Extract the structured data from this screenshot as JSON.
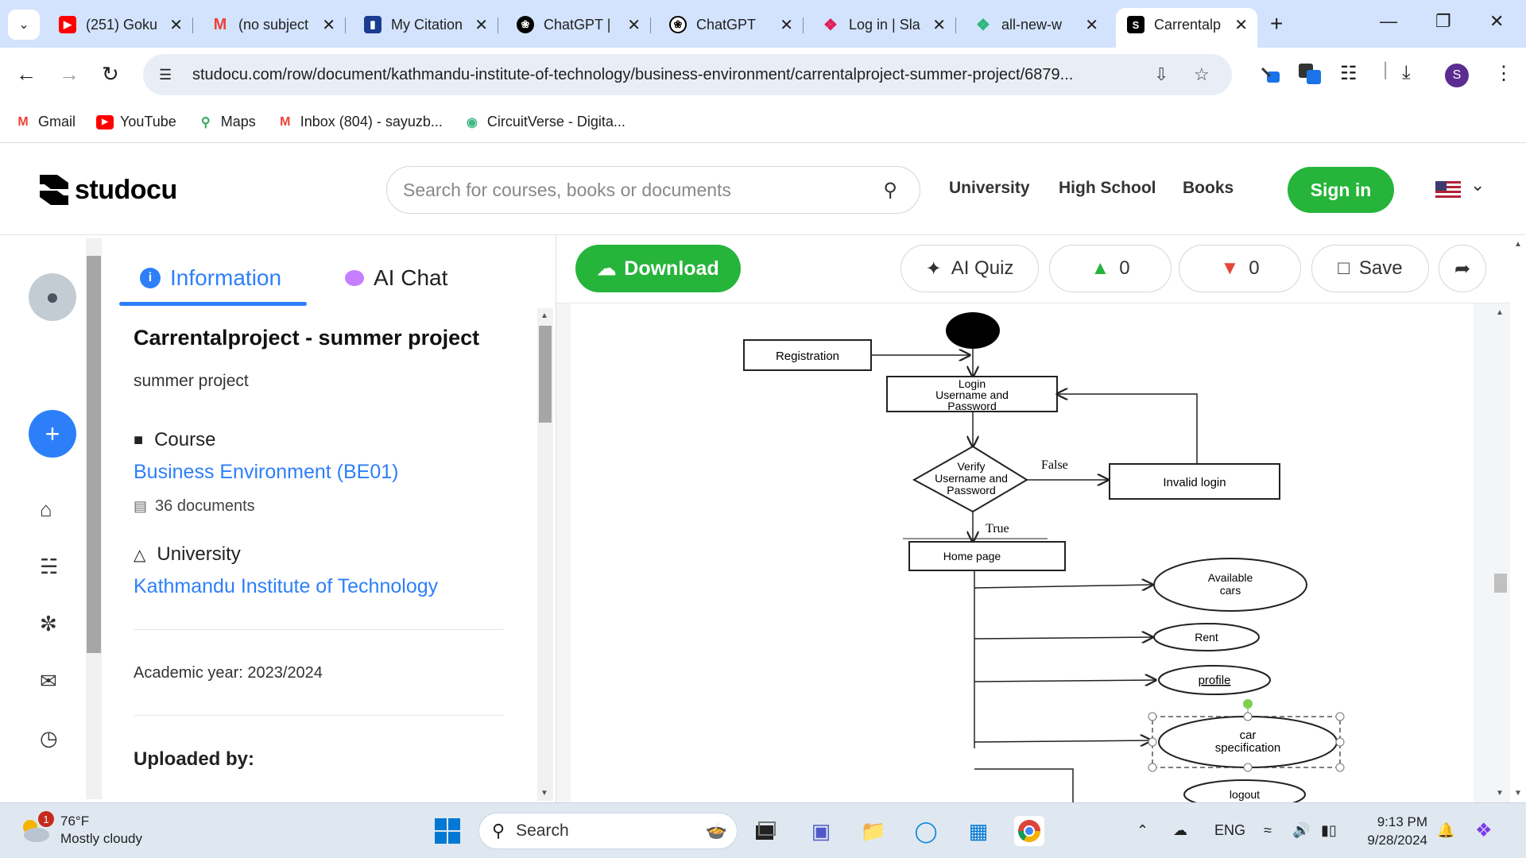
{
  "browser": {
    "tabs": [
      {
        "title": "(251) Goku",
        "icon": "youtube-icon",
        "color": "#ff0000"
      },
      {
        "title": "(no subject",
        "icon": "gmail-icon",
        "color": "#ea4335"
      },
      {
        "title": "My Citation",
        "icon": "citation-icon",
        "color": "#1a3d8f"
      },
      {
        "title": "ChatGPT | ",
        "icon": "chatgpt-icon",
        "color": "#000000"
      },
      {
        "title": "ChatGPT",
        "icon": "chatgpt-icon",
        "color": "#000000"
      },
      {
        "title": "Log in | Sla",
        "icon": "slack-icon",
        "color": "#4a154b"
      },
      {
        "title": "all-new-w",
        "icon": "slack-icon",
        "color": "#4a154b"
      },
      {
        "title": "Carrentalp",
        "icon": "studocu-icon",
        "color": "#000000",
        "active": true
      }
    ],
    "url": "studocu.com/row/document/kathmandu-institute-of-technology/business-environment/carrentalproject-summer-project/6879...",
    "profile_initial": "S",
    "bookmarks": [
      {
        "label": "Gmail",
        "icon": "gmail-icon"
      },
      {
        "label": "YouTube",
        "icon": "youtube-icon"
      },
      {
        "label": "Maps",
        "icon": "maps-icon"
      },
      {
        "label": "Inbox (804) - sayuzb...",
        "icon": "gmail-icon"
      },
      {
        "label": "CircuitVerse - Digita...",
        "icon": "circuitverse-icon"
      }
    ]
  },
  "site": {
    "brand": "studocu",
    "search_placeholder": "Search for courses, books or documents",
    "nav": [
      "University",
      "High School",
      "Books"
    ],
    "signin": "Sign in",
    "accent": "#26b43a",
    "link_color": "#2d7ff9"
  },
  "panel": {
    "tabs": [
      "Information",
      "AI Chat"
    ],
    "title": "Carrentalproject - summer project",
    "subtitle": "summer project",
    "course_label": "Course",
    "course_name": "Business Environment (BE01)",
    "documents": "36 documents",
    "university_label": "University",
    "university_name": "Kathmandu Institute of Technology",
    "academic_year": "Academic year: 2023/2024",
    "uploaded_by": "Uploaded by:"
  },
  "viewer": {
    "download": "Download",
    "ai_quiz": "AI Quiz",
    "likes": "0",
    "dislikes": "0",
    "save": "Save"
  },
  "diagram": {
    "registration": "Registration",
    "login": [
      "Login",
      "Username and",
      "Password"
    ],
    "verify": [
      "Verify",
      "Username and",
      "Password"
    ],
    "false_label": "False",
    "true_label": "True",
    "invalid": "Invalid login",
    "home": "Home page",
    "available": [
      "Available",
      "cars"
    ],
    "rent": "Rent",
    "profile": "profile",
    "car_spec": [
      "car",
      "specification"
    ],
    "logout": "logout"
  },
  "taskbar": {
    "weather_temp": "76°F",
    "weather_desc": "Mostly cloudy",
    "weather_badge": "1",
    "search": "Search",
    "lang": "ENG",
    "time": "9:13 PM",
    "date": "9/28/2024"
  }
}
